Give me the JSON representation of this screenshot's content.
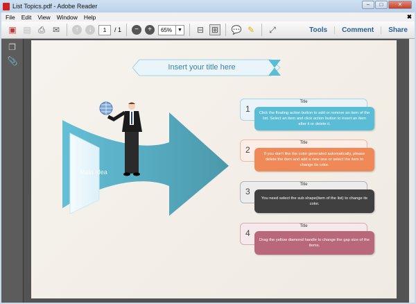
{
  "window": {
    "title": "List Topics.pdf - Adobe Reader"
  },
  "menu": [
    "File",
    "Edit",
    "View",
    "Window",
    "Help"
  ],
  "toolbar": {
    "page_current": "1",
    "page_total": "/ 1",
    "zoom": "65%",
    "tools": "Tools",
    "comment": "Comment",
    "share": "Share"
  },
  "doc": {
    "banner": "Insert your title here",
    "main_idea": "Main Idea",
    "items": [
      {
        "num": "1",
        "title": "Title",
        "text": "Click the floating action button to add or remove an item of the list. Select an item and click action button to insert an item after it or delete it.",
        "color": "#5bbcd6",
        "light": "#eaf4f8",
        "border": "#a9d4e3"
      },
      {
        "num": "2",
        "title": "Title",
        "text": "If you don't like the color generated automatically, please delete the item and add a new one or select the item to change its color.",
        "color": "#ef8a58",
        "light": "#fbeee8",
        "border": "#eeb9a0"
      },
      {
        "num": "3",
        "title": "Title",
        "text": "You need select the sub shape(item of the list) to change its color.",
        "color": "#404040",
        "light": "#ececec",
        "border": "#b4b4b4"
      },
      {
        "num": "4",
        "title": "Title",
        "text": "Drag the yellow diamond handle to change the gap size of the items.",
        "color": "#b9687a",
        "light": "#f5e9ec",
        "border": "#d8aab4"
      }
    ]
  }
}
